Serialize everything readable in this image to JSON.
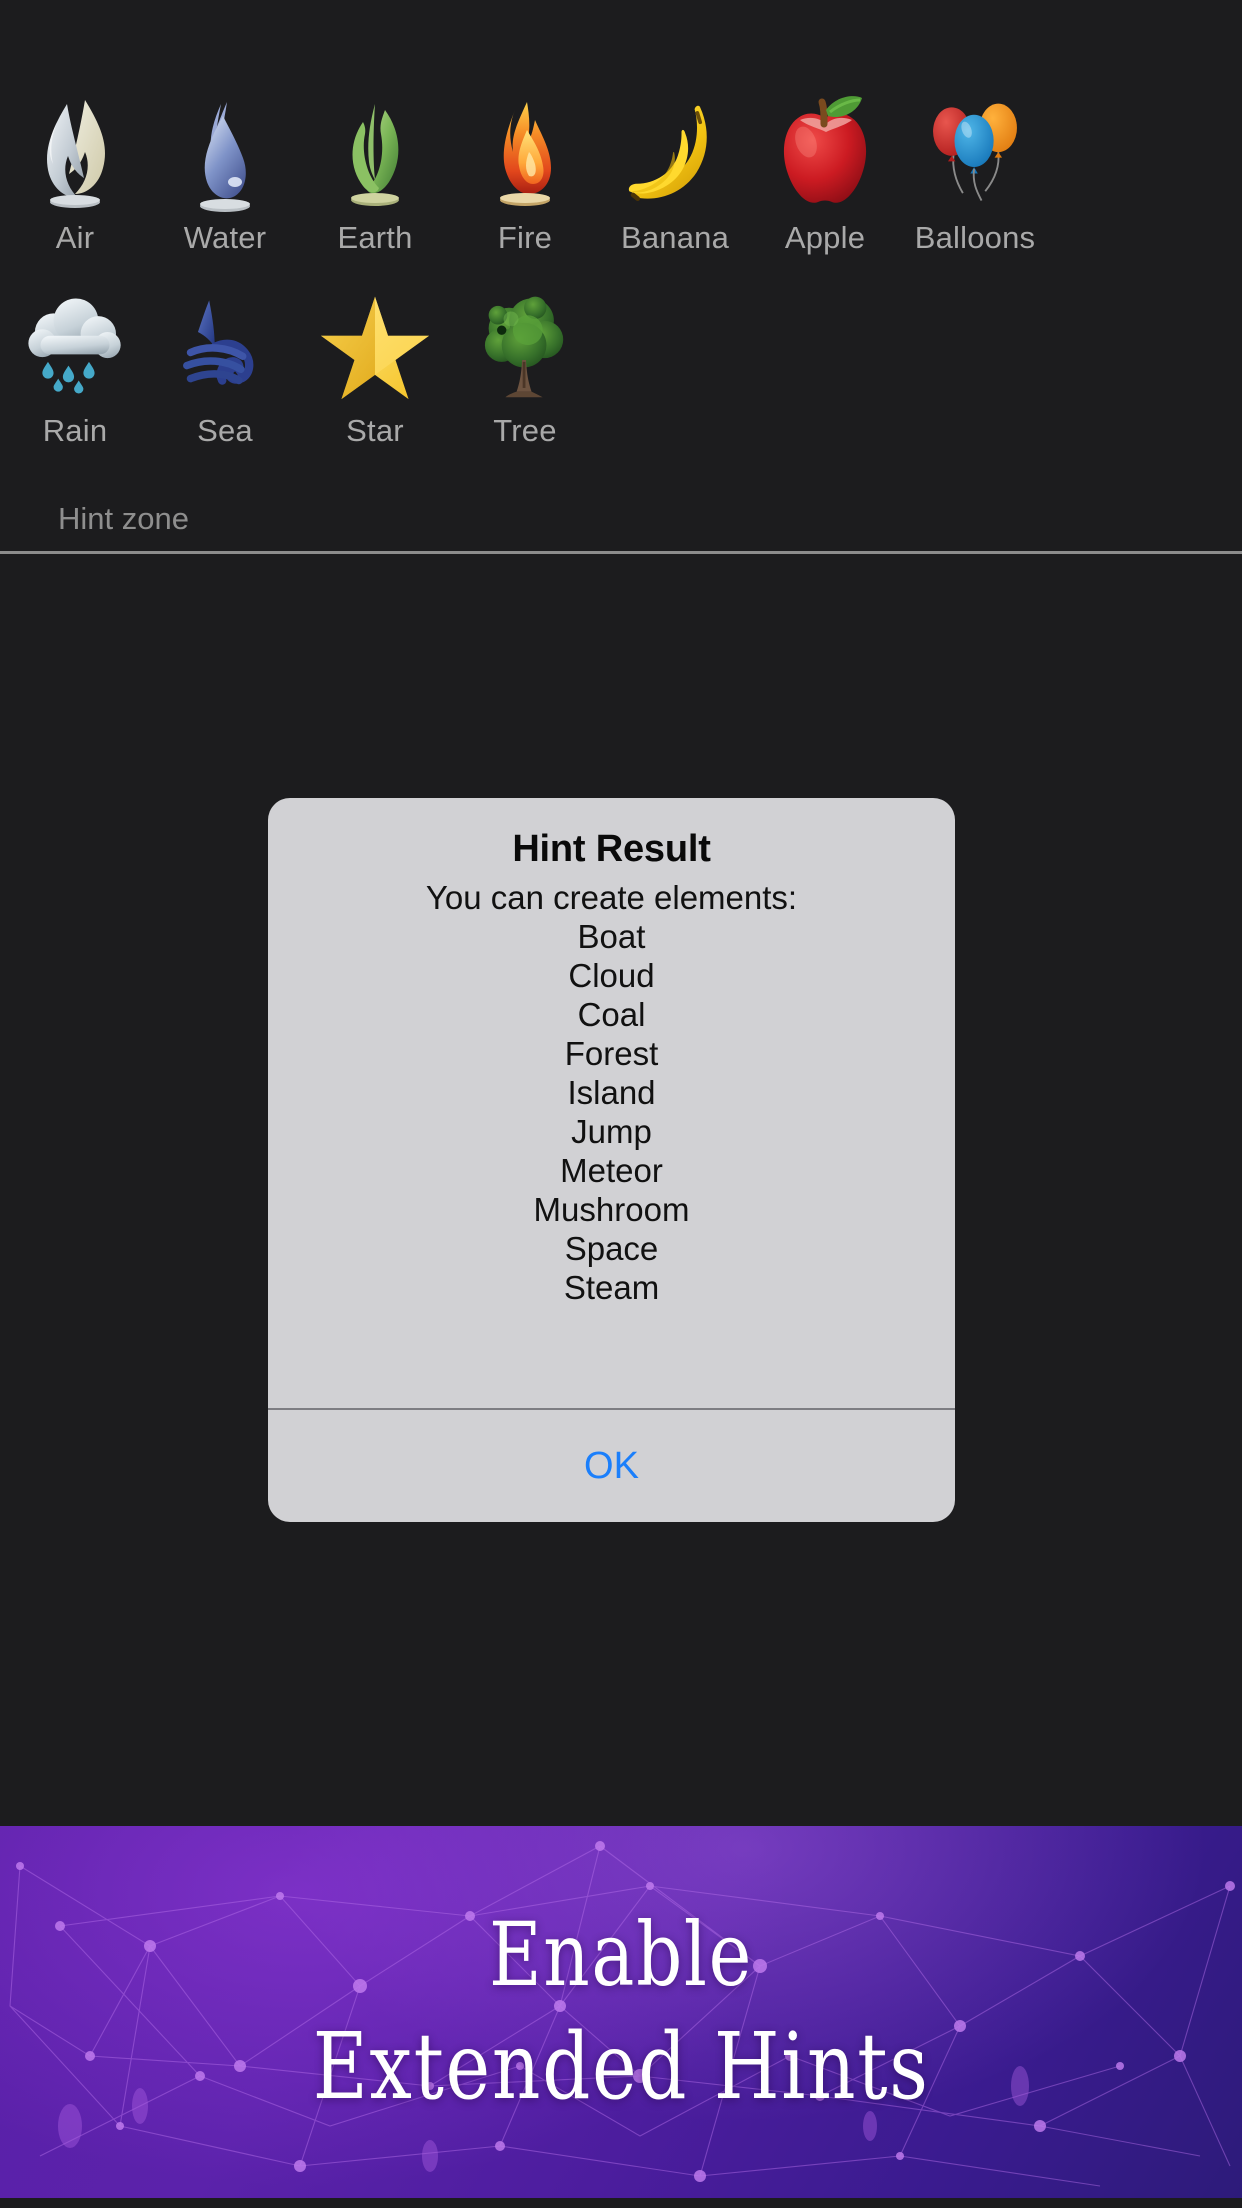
{
  "screen": {
    "background_color": "#1c1c1e",
    "label_color": "#a9a9a9"
  },
  "tray": {
    "hint_zone_label": "Hint zone",
    "rows": [
      [
        {
          "label": "Air",
          "icon": "air-icon"
        },
        {
          "label": "Water",
          "icon": "water-icon"
        },
        {
          "label": "Earth",
          "icon": "earth-icon"
        },
        {
          "label": "Fire",
          "icon": "fire-icon"
        },
        {
          "label": "Banana",
          "icon": "banana-icon"
        },
        {
          "label": "Apple",
          "icon": "apple-icon"
        },
        {
          "label": "Balloons",
          "icon": "balloons-icon"
        }
      ],
      [
        {
          "label": "Rain",
          "icon": "rain-icon"
        },
        {
          "label": "Sea",
          "icon": "sea-icon"
        },
        {
          "label": "Star",
          "icon": "star-icon"
        },
        {
          "label": "Tree",
          "icon": "tree-icon"
        }
      ]
    ]
  },
  "dialog": {
    "title": "Hint Result",
    "message_intro": "You can create elements:",
    "elements": [
      "Boat",
      "Cloud",
      "Coal",
      "Forest",
      "Island",
      "Jump",
      "Meteor",
      "Mushroom",
      "Space",
      "Steam"
    ],
    "ok_label": "OK",
    "ok_color": "#1b7ffb",
    "background_color": "#d1d1d4"
  },
  "ad": {
    "line1": "Enable",
    "line2": "Extended Hints",
    "background_start": "#5a20a8",
    "background_end": "#2d1b7a"
  }
}
